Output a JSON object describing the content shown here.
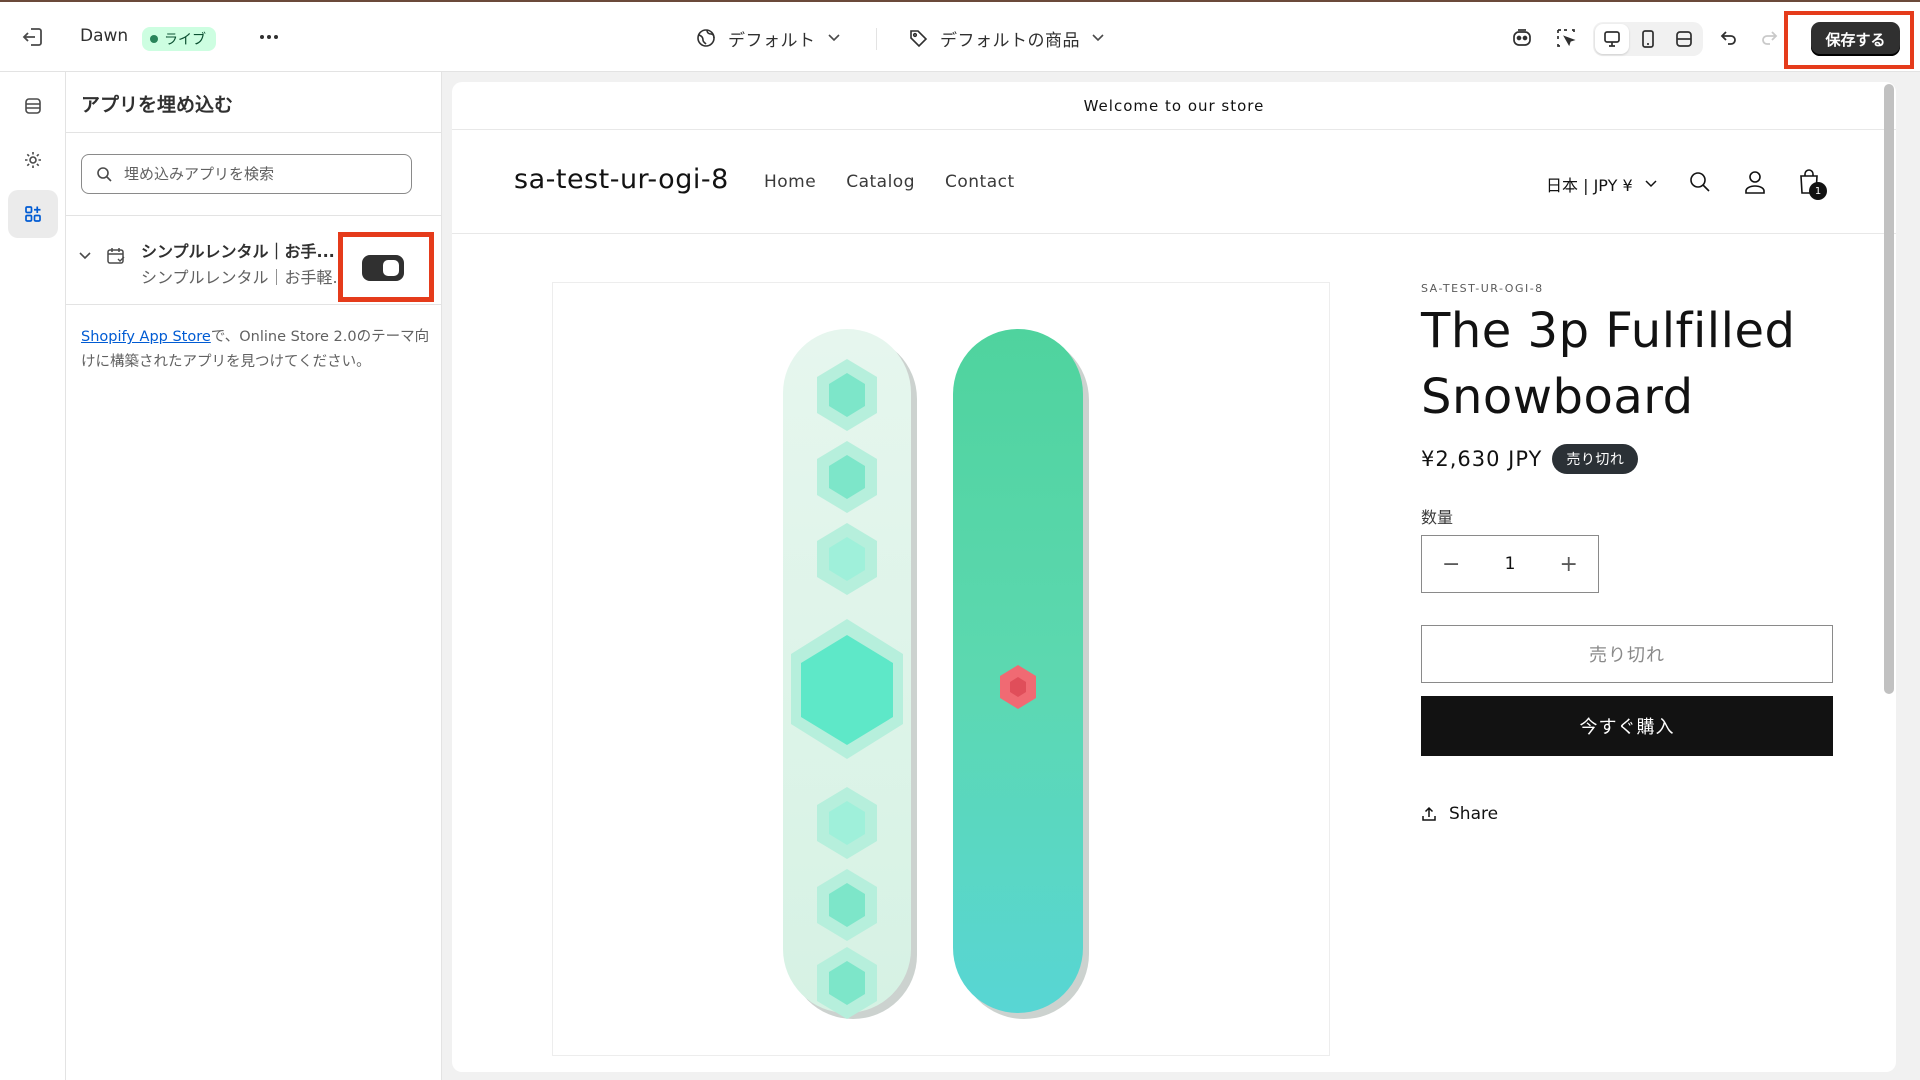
{
  "topbar": {
    "theme_name": "Dawn",
    "live_label": "ライブ",
    "market_dropdown": "デフォルト",
    "template_dropdown": "デフォルトの商品",
    "save_label": "保存する"
  },
  "panel": {
    "title": "アプリを埋め込む",
    "search_placeholder": "埋め込みアプリを検索",
    "app": {
      "name": "シンプルレンタル｜お手...",
      "subtitle": "シンプルレンタル｜お手軽...",
      "enabled": true
    },
    "note_link": "Shopify App Store",
    "note_text": "で、Online Store 2.0のテーマ向けに構築されたアプリを見つけてください。"
  },
  "preview": {
    "announcement": "Welcome to our store",
    "store_name": "sa-test-ur-ogi-8",
    "nav": [
      "Home",
      "Catalog",
      "Contact"
    ],
    "locale": "日本 | JPY ¥",
    "cart_count": "1",
    "product": {
      "vendor": "SA-TEST-UR-OGI-8",
      "title": "The 3p Fulfilled Snowboard",
      "price": "¥2,630 JPY",
      "badge": "売り切れ",
      "quantity_label": "数量",
      "quantity": "1",
      "minus": "−",
      "plus": "+",
      "soldout_button": "売り切れ",
      "buy_button": "今すぐ購入",
      "share": "Share"
    }
  },
  "colors": {
    "accent_dark": "#303030",
    "highlight": "#e53b1b",
    "live_bg": "#cdfee1",
    "link": "#005bd3"
  }
}
